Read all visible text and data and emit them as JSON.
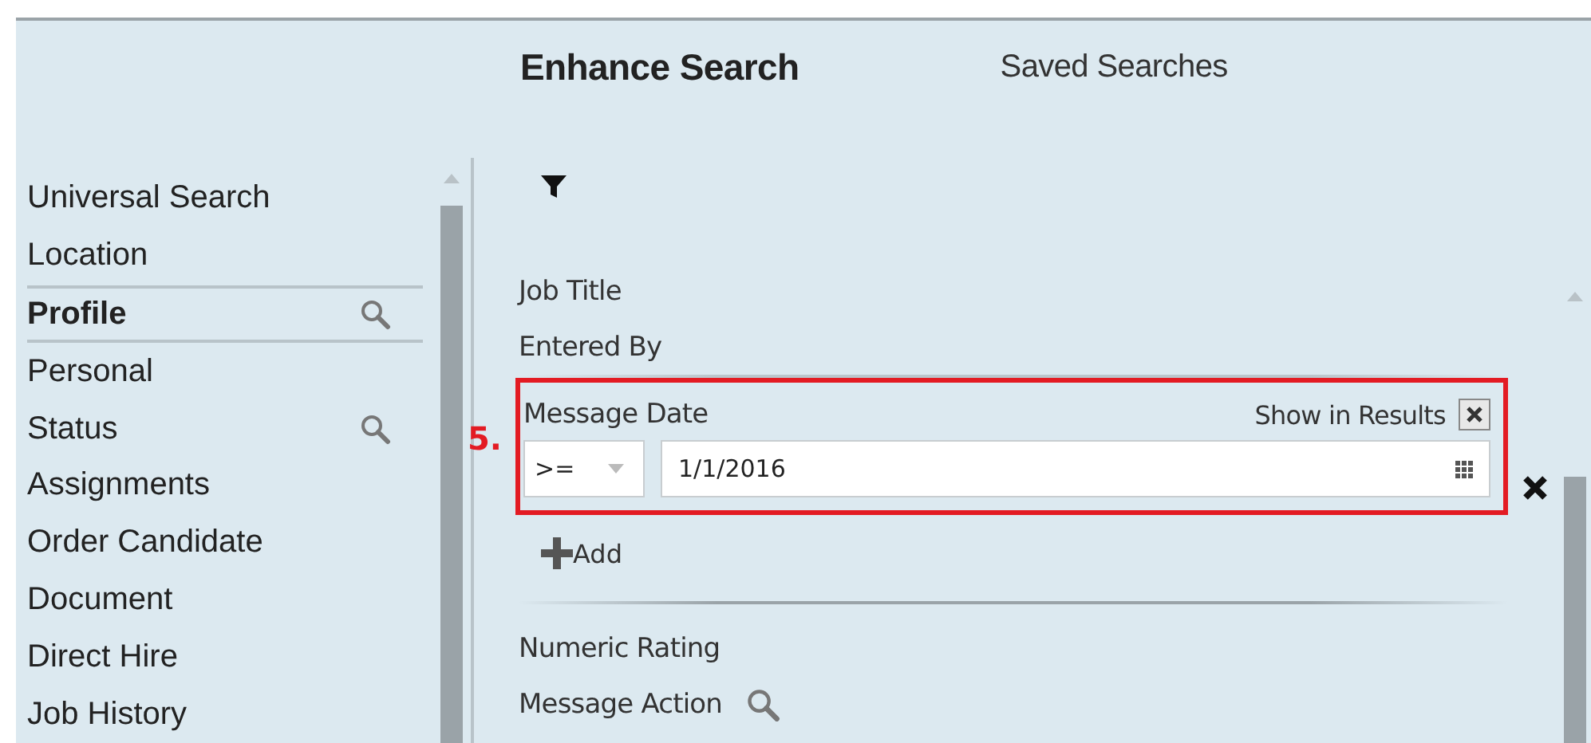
{
  "tabs": [
    {
      "label": "Enhance Search",
      "selected": true
    },
    {
      "label": "Saved Searches",
      "selected": false
    }
  ],
  "sidebar": {
    "items": [
      {
        "label": "Universal Search",
        "selected": false,
        "searchable": false
      },
      {
        "label": "Location",
        "selected": false,
        "searchable": false
      },
      {
        "label": "Profile",
        "selected": true,
        "searchable": true
      },
      {
        "label": "Personal",
        "selected": false,
        "searchable": false
      },
      {
        "label": "Status",
        "selected": false,
        "searchable": true
      },
      {
        "label": "Assignments",
        "selected": false,
        "searchable": false
      },
      {
        "label": "Order Candidate",
        "selected": false,
        "searchable": false
      },
      {
        "label": "Document",
        "selected": false,
        "searchable": false
      },
      {
        "label": "Direct Hire",
        "selected": false,
        "searchable": false
      },
      {
        "label": "Job History",
        "selected": false,
        "searchable": false
      }
    ]
  },
  "fields": [
    {
      "kind": "plain",
      "label": "Job Title",
      "searchable": false
    },
    {
      "kind": "plain",
      "label": "Entered By",
      "searchable": false
    },
    {
      "kind": "expanded",
      "label": "Message Date",
      "annotation": "5.",
      "show_in_results": {
        "label": "Show in Results",
        "checked": true
      },
      "operator": ">=",
      "value": "1/1/2016",
      "add_label": "Add"
    },
    {
      "kind": "plain",
      "label": "Numeric Rating",
      "searchable": false
    },
    {
      "kind": "plain",
      "label": "Message Action",
      "searchable": true
    }
  ]
}
